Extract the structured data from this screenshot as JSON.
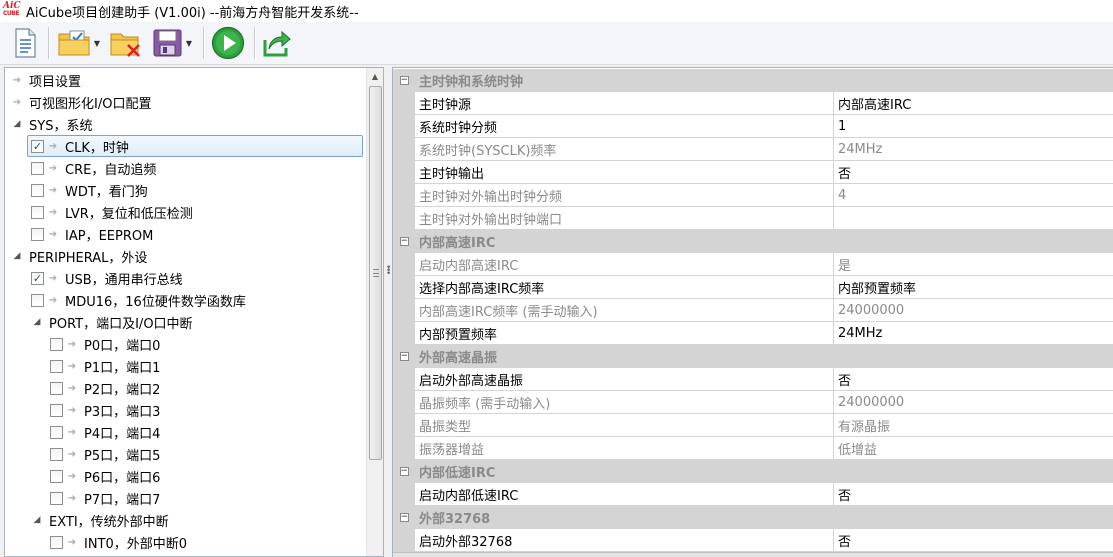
{
  "window": {
    "logo_line1": "AiC",
    "logo_line2": "CUBE",
    "title": "AiCube项目创建助手 (V1.00i) --前海方舟智能开发系统--"
  },
  "toolbar": {
    "buttons": [
      {
        "name": "new-project",
        "icon": "new-document-icon"
      },
      {
        "name": "open-project",
        "icon": "open-folder-icon",
        "dropdown": true
      },
      {
        "name": "close-project",
        "icon": "folder-delete-icon"
      },
      {
        "name": "save-project",
        "icon": "save-icon",
        "dropdown": true
      },
      {
        "name": "run",
        "icon": "run-icon"
      },
      {
        "name": "export",
        "icon": "export-icon"
      }
    ]
  },
  "tree": {
    "items": [
      {
        "label": "项目设置",
        "level": 0,
        "expander": "leaf",
        "checkbox": null
      },
      {
        "label": "可视图形化I/O口配置",
        "level": 0,
        "expander": "leaf",
        "checkbox": null
      },
      {
        "label": "SYS，系统",
        "level": 0,
        "expander": "open",
        "checkbox": null
      },
      {
        "label": "CLK，时钟",
        "level": 1,
        "expander": "leaf",
        "checkbox": true,
        "selected": true
      },
      {
        "label": "CRE，自动追频",
        "level": 1,
        "expander": "leaf",
        "checkbox": false
      },
      {
        "label": "WDT，看门狗",
        "level": 1,
        "expander": "leaf",
        "checkbox": false
      },
      {
        "label": "LVR，复位和低压检测",
        "level": 1,
        "expander": "leaf",
        "checkbox": false
      },
      {
        "label": "IAP，EEPROM",
        "level": 1,
        "expander": "leaf",
        "checkbox": false
      },
      {
        "label": "PERIPHERAL，外设",
        "level": 0,
        "expander": "open",
        "checkbox": null
      },
      {
        "label": "USB，通用串行总线",
        "level": 1,
        "expander": "leaf",
        "checkbox": true
      },
      {
        "label": "MDU16，16位硬件数学函数库",
        "level": 1,
        "expander": "leaf",
        "checkbox": false
      },
      {
        "label": "PORT，端口及I/O口中断",
        "level": 1,
        "expander": "open",
        "checkbox": null
      },
      {
        "label": "P0口，端口0",
        "level": 2,
        "expander": "leaf",
        "checkbox": false
      },
      {
        "label": "P1口，端口1",
        "level": 2,
        "expander": "leaf",
        "checkbox": false
      },
      {
        "label": "P2口，端口2",
        "level": 2,
        "expander": "leaf",
        "checkbox": false
      },
      {
        "label": "P3口，端口3",
        "level": 2,
        "expander": "leaf",
        "checkbox": false
      },
      {
        "label": "P4口，端口4",
        "level": 2,
        "expander": "leaf",
        "checkbox": false
      },
      {
        "label": "P5口，端口5",
        "level": 2,
        "expander": "leaf",
        "checkbox": false
      },
      {
        "label": "P6口，端口6",
        "level": 2,
        "expander": "leaf",
        "checkbox": false
      },
      {
        "label": "P7口，端口7",
        "level": 2,
        "expander": "leaf",
        "checkbox": false
      },
      {
        "label": "EXTI，传统外部中断",
        "level": 1,
        "expander": "open",
        "checkbox": null
      },
      {
        "label": "INT0，外部中断0",
        "level": 2,
        "expander": "leaf",
        "checkbox": false
      }
    ]
  },
  "property_grid": {
    "rows": [
      {
        "type": "category",
        "label": "主时钟和系统时钟"
      },
      {
        "type": "prop",
        "name": "主时钟源",
        "value": "内部高速IRC",
        "readonly": false
      },
      {
        "type": "prop",
        "name": "系统时钟分频",
        "value": "1",
        "readonly": false
      },
      {
        "type": "prop",
        "name": "系统时钟(SYSCLK)频率",
        "value": "24MHz",
        "readonly": true
      },
      {
        "type": "prop",
        "name": "主时钟输出",
        "value": "否",
        "readonly": false
      },
      {
        "type": "prop",
        "name": "主时钟对外输出时钟分频",
        "value": "4",
        "readonly": true
      },
      {
        "type": "prop",
        "name": "主时钟对外输出时钟端口",
        "value": "",
        "readonly": true
      },
      {
        "type": "category",
        "label": "内部高速IRC"
      },
      {
        "type": "prop",
        "name": "启动内部高速IRC",
        "value": "是",
        "readonly": true
      },
      {
        "type": "prop",
        "name": "选择内部高速IRC频率",
        "value": "内部预置频率",
        "readonly": false
      },
      {
        "type": "prop",
        "name": "内部高速IRC频率 (需手动输入)",
        "value": "24000000",
        "readonly": true
      },
      {
        "type": "prop",
        "name": "内部预置频率",
        "value": "24MHz",
        "readonly": false
      },
      {
        "type": "category",
        "label": "外部高速晶振"
      },
      {
        "type": "prop",
        "name": "启动外部高速晶振",
        "value": "否",
        "readonly": false
      },
      {
        "type": "prop",
        "name": "晶振频率 (需手动输入)",
        "value": "24000000",
        "readonly": true
      },
      {
        "type": "prop",
        "name": "晶振类型",
        "value": "有源晶振",
        "readonly": true
      },
      {
        "type": "prop",
        "name": "振荡器增益",
        "value": "低增益",
        "readonly": true
      },
      {
        "type": "category",
        "label": "内部低速IRC"
      },
      {
        "type": "prop",
        "name": "启动内部低速IRC",
        "value": "否",
        "readonly": false
      },
      {
        "type": "category",
        "label": "外部32768"
      },
      {
        "type": "prop",
        "name": "启动外部32768",
        "value": "否",
        "readonly": false
      }
    ]
  },
  "colors": {
    "category_bg": "#d4d4d4",
    "readonly_text": "#8a8a8a",
    "selection_border": "#7da2ce"
  }
}
